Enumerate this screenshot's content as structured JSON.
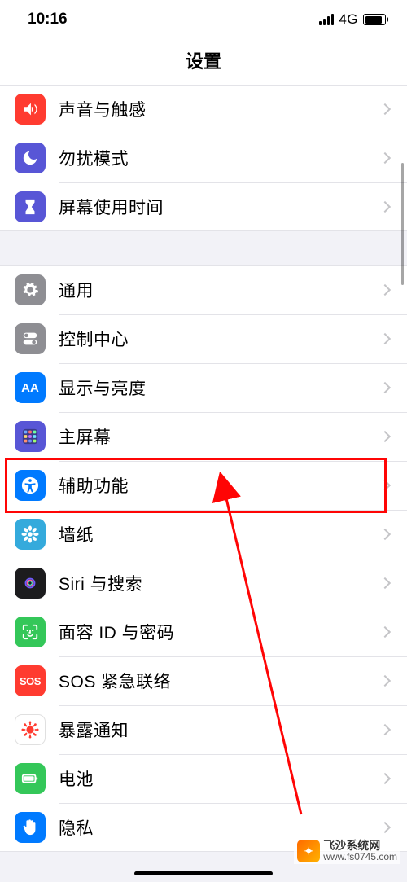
{
  "status": {
    "time": "10:16",
    "network": "4G"
  },
  "nav": {
    "title": "设置"
  },
  "groups": [
    {
      "rows": [
        {
          "key": "sounds",
          "label": "声音与触感",
          "icon": "speaker-icon",
          "bg": "bg-red"
        },
        {
          "key": "dnd",
          "label": "勿扰模式",
          "icon": "moon-icon",
          "bg": "bg-purple"
        },
        {
          "key": "screentime",
          "label": "屏幕使用时间",
          "icon": "hourglass-icon",
          "bg": "bg-indigo"
        }
      ]
    },
    {
      "rows": [
        {
          "key": "general",
          "label": "通用",
          "icon": "gear-icon",
          "bg": "bg-gray"
        },
        {
          "key": "controlcenter",
          "label": "控制中心",
          "icon": "toggles-icon",
          "bg": "bg-gray"
        },
        {
          "key": "display",
          "label": "显示与亮度",
          "icon": "text-size-icon",
          "bg": "bg-blue",
          "text": "AA"
        },
        {
          "key": "homescreen",
          "label": "主屏幕",
          "icon": "grid-icon",
          "bg": "bg-indigo"
        },
        {
          "key": "accessibility",
          "label": "辅助功能",
          "icon": "accessibility-icon",
          "bg": "bg-blue",
          "highlight": true
        },
        {
          "key": "wallpaper",
          "label": "墙纸",
          "icon": "flower-icon",
          "bg": "bg-lblue"
        },
        {
          "key": "siri",
          "label": "Siri 与搜索",
          "icon": "siri-icon",
          "bg": "bg-black"
        },
        {
          "key": "faceid",
          "label": "面容 ID 与密码",
          "icon": "faceid-icon",
          "bg": "bg-green"
        },
        {
          "key": "sos",
          "label": "SOS 紧急联络",
          "icon": "sos-icon",
          "bg": "bg-red",
          "text": "SOS"
        },
        {
          "key": "exposure",
          "label": "暴露通知",
          "icon": "virus-icon",
          "bg": "bg-white"
        },
        {
          "key": "battery",
          "label": "电池",
          "icon": "battery-icon",
          "bg": "bg-green"
        },
        {
          "key": "privacy",
          "label": "隐私",
          "icon": "hand-icon",
          "bg": "bg-blue"
        }
      ]
    }
  ],
  "watermark": {
    "brand": "飞沙系统网",
    "url": "www.fs0745.com"
  }
}
